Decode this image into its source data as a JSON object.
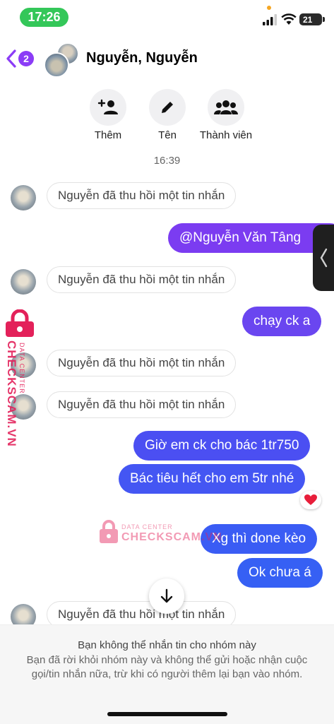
{
  "status_bar": {
    "time": "17:26",
    "battery": "21"
  },
  "header": {
    "back_badge": "2",
    "title": "Nguyễn, Nguyễn"
  },
  "actions": [
    {
      "label": "Thêm",
      "icon": "add-person-icon"
    },
    {
      "label": "Tên",
      "icon": "pencil-icon"
    },
    {
      "label": "Thành viên",
      "icon": "group-icon"
    }
  ],
  "timestamp": "16:39",
  "messages": [
    {
      "type": "system",
      "text": "Nguyễn đã thu hồi một tin nhắn"
    },
    {
      "type": "outgoing",
      "text": "@Nguyễn Văn Tâng"
    },
    {
      "type": "system",
      "text": "Nguyễn đã thu hồi một tin nhắn"
    },
    {
      "type": "outgoing",
      "text": "chạy ck a"
    },
    {
      "type": "system",
      "text": "Nguyễn đã thu hồi một tin nhắn"
    },
    {
      "type": "system",
      "text": "Nguyễn đã thu hồi một tin nhắn"
    },
    {
      "type": "outgoing",
      "text": "Giờ em ck cho bác 1tr750"
    },
    {
      "type": "outgoing",
      "text": "Bác tiêu hết cho em 5tr nhé",
      "reaction": "heart"
    },
    {
      "type": "outgoing",
      "text": "Xg thì done kèo"
    },
    {
      "type": "outgoing",
      "text": "Ok chưa á"
    },
    {
      "type": "system",
      "text": "Nguyễn đã thu hồi một tin nhắn"
    }
  ],
  "watermark": {
    "label": "DATA CENTER",
    "brand": "CHECKSCAM.VN"
  },
  "notice": {
    "title": "Bạn không thể nhắn tin cho nhóm này",
    "body": "Bạn đã rời khỏi nhóm này và không thể gửi hoặc nhận cuộc gọi/tin nhắn nữa, trừ khi có người thêm lại bạn vào nhóm."
  },
  "colors": {
    "accent": "#8b3cf6",
    "status_green": "#34c759",
    "watermark": "#e3215a"
  }
}
